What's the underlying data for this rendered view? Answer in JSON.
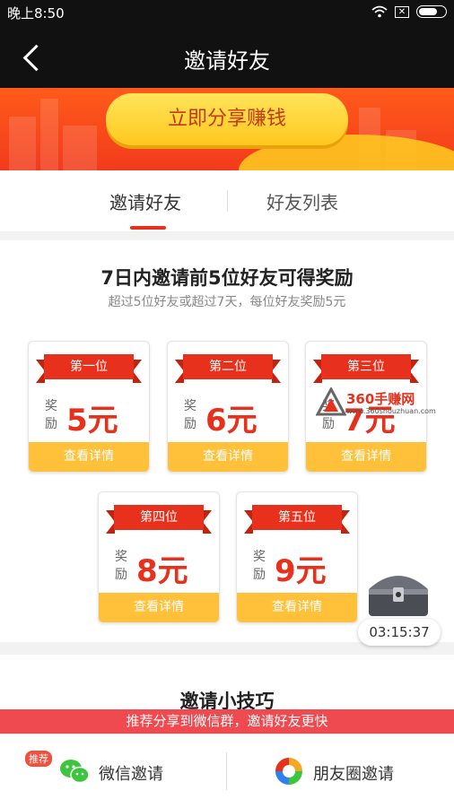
{
  "status_bar": {
    "time": "晚上8:50",
    "sim_icon": "sim-x-icon"
  },
  "nav": {
    "title": "邀请好友"
  },
  "banner": {
    "share_button": "立即分享赚钱"
  },
  "tabs": [
    {
      "label": "邀请好友",
      "active": true
    },
    {
      "label": "好友列表",
      "active": false
    }
  ],
  "rewards": {
    "heading": "7日内邀请前5位好友可得奖励",
    "subheading": "超过5位好友或超过7天，每位好友奖励5元",
    "reward_word": "奖励",
    "detail_label": "查看详情",
    "cards": [
      {
        "rank": "第一位",
        "amount": "5元"
      },
      {
        "rank": "第二位",
        "amount": "6元"
      },
      {
        "rank": "第三位",
        "amount": "7元"
      },
      {
        "rank": "第四位",
        "amount": "8元"
      },
      {
        "rank": "第五位",
        "amount": "9元"
      }
    ]
  },
  "treasure": {
    "timer": "03:15:37"
  },
  "tips": {
    "title": "邀请小技巧"
  },
  "promo_bar": "推荐分享到微信群，邀请好友更快",
  "bottom": {
    "wechat": {
      "badge": "推荐",
      "label": "微信邀请"
    },
    "moments": {
      "label": "朋友圈邀请"
    }
  },
  "watermark": {
    "text": "360手赚网",
    "url": "www.360shouzhuan.com"
  },
  "colors": {
    "accent_red": "#e8311c",
    "gold": "#ffc03a",
    "wechat_green": "#3ec53e"
  }
}
